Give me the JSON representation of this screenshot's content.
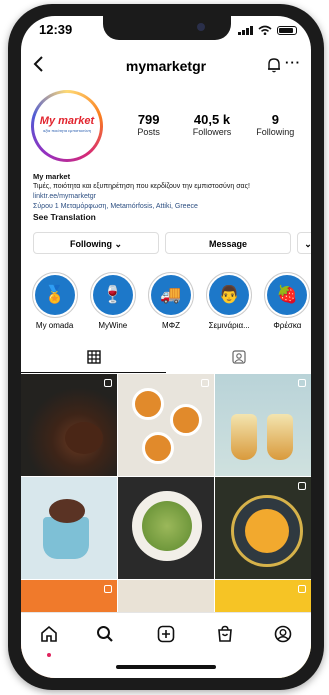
{
  "status": {
    "time": "12:39"
  },
  "header": {
    "username": "mymarketgr",
    "back_icon": "chevron-left-icon",
    "notify_icon": "bell-icon",
    "more_label": "···"
  },
  "profile": {
    "avatar_logo_main": "My market",
    "avatar_logo_sub": "αξία ποιότητα εμπιστοσύνη",
    "stats": [
      {
        "value": "799",
        "label": "Posts"
      },
      {
        "value": "40,5 k",
        "label": "Followers"
      },
      {
        "value": "9",
        "label": "Following"
      }
    ]
  },
  "bio": {
    "name": "My market",
    "text": "Τιμές, ποιότητα και εξυπηρέτηση που κερδίζουν την εμπιστοσύνη σας!",
    "link": "linktr.ee/mymarketgr",
    "location": "Σύρου 1 Μεταμόρφωση, Metamórfosis, Attiki, Greece",
    "see_translation": "See Translation"
  },
  "actions": {
    "following": "Following ⌄",
    "message": "Message",
    "more": "⌄"
  },
  "highlights": [
    {
      "label": "My omada",
      "icon": "medal-icon",
      "glyph": "🏅"
    },
    {
      "label": "MyWine",
      "icon": "wine-glasses-icon",
      "glyph": "🍷"
    },
    {
      "label": "ΜΦΖ",
      "icon": "truck-icon",
      "glyph": "🚚"
    },
    {
      "label": "Σεμινάρια...",
      "icon": "chef-icon",
      "glyph": "👨"
    },
    {
      "label": "Φρέσκα",
      "icon": "strawberry-icon",
      "glyph": "🍓"
    }
  ],
  "tabs": {
    "grid_icon": "grid-icon",
    "tagged_icon": "tagged-icon"
  },
  "nav": {
    "home": "home-icon",
    "search": "search-icon",
    "add": "add-icon",
    "shop": "shop-icon",
    "profile": "profile-icon"
  },
  "colors": {
    "brand_blue": "#1d78c9",
    "link": "#2d4f82"
  }
}
